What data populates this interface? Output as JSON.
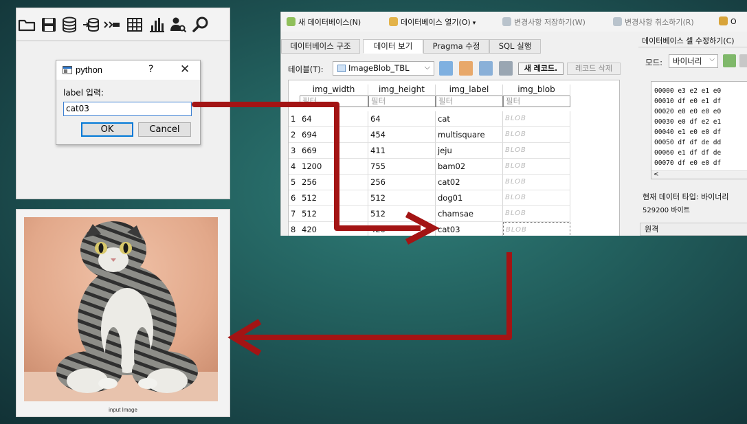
{
  "tk_dialog": {
    "title": "python",
    "help_glyph": "?",
    "close_glyph": "✕",
    "prompt": "label 입력:",
    "input_value": "cat03",
    "ok_label": "OK",
    "cancel_label": "Cancel"
  },
  "image_panel": {
    "caption": "input Image"
  },
  "db_browser": {
    "toolbar": [
      {
        "label": "새 데이터베이스(N)",
        "disabled": false
      },
      {
        "label": "데이터베이스 열기(O)",
        "disabled": false
      },
      {
        "label": "변경사항 저장하기(W)",
        "disabled": true
      },
      {
        "label": "변경사항 취소하기(R)",
        "disabled": true
      },
      {
        "label": "O",
        "disabled": false
      }
    ],
    "tabs": [
      "데이터베이스 구조",
      "데이터 보기",
      "Pragma 수정",
      "SQL 실행"
    ],
    "active_tab": "데이터 보기",
    "table_label": "테이블(T):",
    "table_name": "ImageBlob_TBL",
    "new_record_label": "새 레코드.",
    "delete_record_label": "레코드 삭제",
    "columns": [
      "img_width",
      "img_height",
      "img_label",
      "img_blob"
    ],
    "filter_placeholder": "필터",
    "rows": [
      {
        "n": "1",
        "w": "64",
        "h": "64",
        "label": "cat",
        "blob": "BLOB"
      },
      {
        "n": "2",
        "w": "694",
        "h": "454",
        "label": "multisquare",
        "blob": "BLOB"
      },
      {
        "n": "3",
        "w": "669",
        "h": "411",
        "label": "jeju",
        "blob": "BLOB"
      },
      {
        "n": "4",
        "w": "1200",
        "h": "755",
        "label": "bam02",
        "blob": "BLOB"
      },
      {
        "n": "5",
        "w": "256",
        "h": "256",
        "label": "cat02",
        "blob": "BLOB"
      },
      {
        "n": "6",
        "w": "512",
        "h": "512",
        "label": "dog01",
        "blob": "BLOB"
      },
      {
        "n": "7",
        "w": "512",
        "h": "512",
        "label": "chamsae",
        "blob": "BLOB"
      },
      {
        "n": "8",
        "w": "420",
        "h": "420",
        "label": "cat03",
        "blob": "BLOB"
      }
    ],
    "cell_panel": {
      "title": "데이터베이스 셀 수정하기(C)",
      "mode_label": "모드:",
      "mode_value": "바이너리",
      "hex_lines": [
        "00000 e3 e2 e1 e0",
        "00010 df e0 e1 df",
        "00020 e0 e0 e0 e0",
        "00030 e0 df e2 e1",
        "00040 e1 e0 e0 df",
        "00050 df df de dd",
        "00060 e1 df df de",
        "00070 df e0 e0 df"
      ],
      "scroll_glyph": "<",
      "type_text": "현재 데이터 타입: 바이너리",
      "size_text": "529200 바이트",
      "remote_label": "원격"
    }
  },
  "colors": {
    "arrow": "#a31414",
    "accent": "#0078d7"
  }
}
